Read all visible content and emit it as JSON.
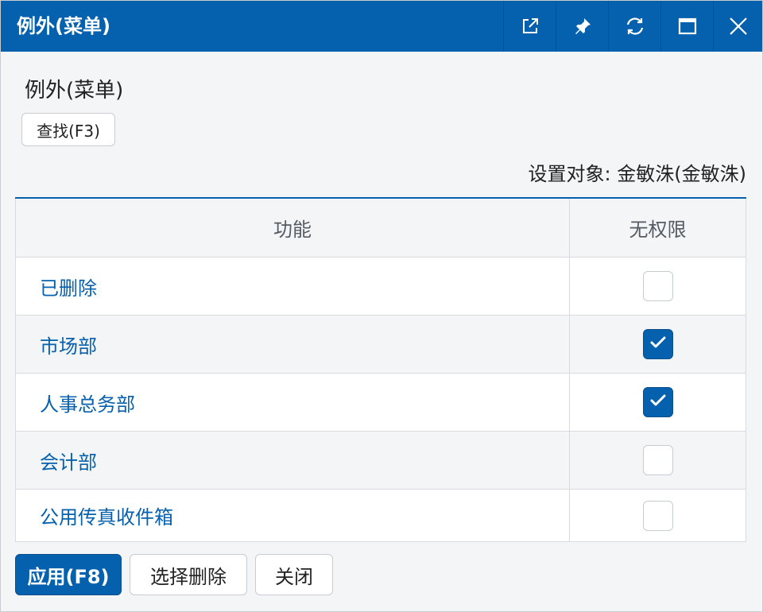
{
  "window": {
    "title": "例外(菜单)",
    "titlebar_buttons": [
      {
        "icon": "external-link-icon"
      },
      {
        "icon": "pin-icon"
      },
      {
        "icon": "refresh-icon"
      },
      {
        "icon": "maximize-icon"
      },
      {
        "icon": "close-icon"
      }
    ]
  },
  "page": {
    "title": "例外(菜单)",
    "find_button": "查找(F3)",
    "target_label": "设置对象: 金敏洙(金敏洙)"
  },
  "table": {
    "columns": [
      "功能",
      "无权限"
    ],
    "rows": [
      {
        "function": "已删除",
        "no_permission": false
      },
      {
        "function": "市场部",
        "no_permission": true
      },
      {
        "function": "人事总务部",
        "no_permission": true
      },
      {
        "function": "会计部",
        "no_permission": false
      },
      {
        "function": "公用传真收件箱",
        "no_permission": false
      }
    ]
  },
  "footer": {
    "apply_button": "应用(F8)",
    "delete_button": "选择删除",
    "close_button": "关闭"
  },
  "colors": {
    "accent": "#0561ad",
    "titlebar_text": "#ffffff",
    "link": "#0561ad",
    "background": "#f4f5f7"
  }
}
